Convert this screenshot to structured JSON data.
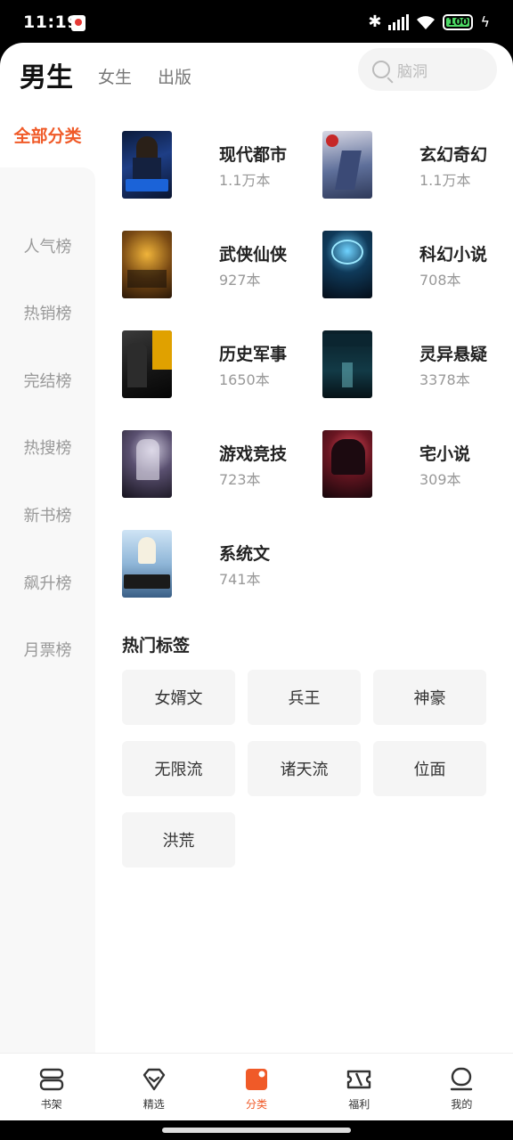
{
  "status_bar": {
    "time": "11:19",
    "battery": "100"
  },
  "topnav": {
    "tab_male": "男生",
    "tab_female": "女生",
    "tab_publish": "出版",
    "search_placeholder": "脑洞"
  },
  "sidebar": {
    "active": "全部分类",
    "items": [
      "人气榜",
      "热销榜",
      "完结榜",
      "热搜榜",
      "新书榜",
      "飙升榜",
      "月票榜"
    ]
  },
  "categories": [
    {
      "name": "现代都市",
      "count": "1.1万本",
      "cover": "cover-dushi"
    },
    {
      "name": "玄幻奇幻",
      "count": "1.1万本",
      "cover": "cover-xuanhuan"
    },
    {
      "name": "武侠仙侠",
      "count": "927本",
      "cover": "cover-wuxia"
    },
    {
      "name": "科幻小说",
      "count": "708本",
      "cover": "cover-kehuan"
    },
    {
      "name": "历史军事",
      "count": "1650本",
      "cover": "cover-lishi"
    },
    {
      "name": "灵异悬疑",
      "count": "3378本",
      "cover": "cover-lingyi"
    },
    {
      "name": "游戏竞技",
      "count": "723本",
      "cover": "cover-youxi"
    },
    {
      "name": "宅小说",
      "count": "309本",
      "cover": "cover-zhai"
    },
    {
      "name": "系统文",
      "count": "741本",
      "cover": "cover-xitong"
    }
  ],
  "hot_tags": {
    "title": "热门标签",
    "tags": [
      "女婿文",
      "兵王",
      "神豪",
      "无限流",
      "诸天流",
      "位面",
      "洪荒"
    ]
  },
  "tabbar": {
    "items": [
      {
        "label": "书架",
        "icon": "bookshelf-icon"
      },
      {
        "label": "精选",
        "icon": "featured-icon"
      },
      {
        "label": "分类",
        "icon": "category-icon"
      },
      {
        "label": "福利",
        "icon": "ticket-icon"
      },
      {
        "label": "我的",
        "icon": "profile-icon"
      }
    ],
    "active_index": 2
  },
  "colors": {
    "accent": "#f05a28"
  }
}
